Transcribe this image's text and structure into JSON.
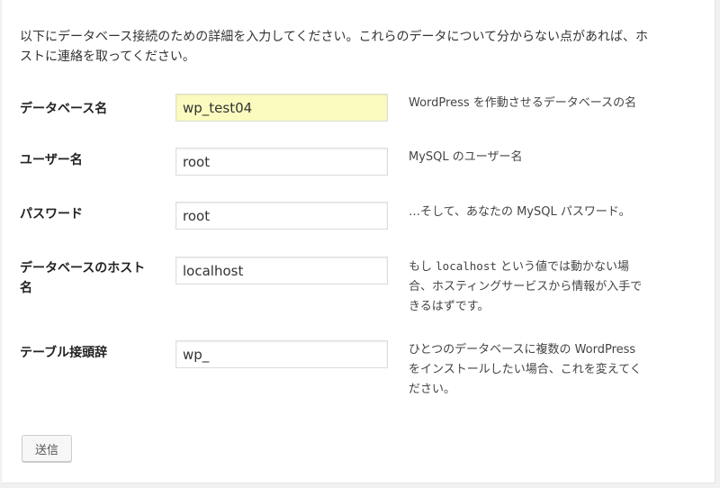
{
  "intro": {
    "line1": "以下にデータベース接続のための詳細を入力してください。これらのデータについて分からない点があれば、ホ",
    "line2": "ストに連絡を取ってください。"
  },
  "fields": {
    "dbname": {
      "label": "データベース名",
      "value": "wp_test04",
      "description": "WordPress を作動させるデータベースの名"
    },
    "username": {
      "label": "ユーザー名",
      "value": "root",
      "description": "MySQL のユーザー名"
    },
    "password": {
      "label": "パスワード",
      "value": "root",
      "description": "…そして、あなたの MySQL パスワード。"
    },
    "dbhost": {
      "label_line1": "データベースのホスト",
      "label_line2": "名",
      "value": "localhost",
      "description_pre": "もし ",
      "description_code": "localhost",
      "description_post": " という値では動かない場",
      "description_line2": "合、ホスティングサービスから情報が入手で",
      "description_line3": "きるはずです。"
    },
    "prefix": {
      "label": "テーブル接頭辞",
      "value": "wp_",
      "description_line1": "ひとつのデータベースに複数の WordPress",
      "description_line2": "をインストールしたい場合、これを変えてく",
      "description_line3": "ださい。"
    }
  },
  "submit_label": "送信",
  "colors": {
    "highlight_field": "#fbfbbf",
    "page_background": "#f1f1f1",
    "panel_background": "#ffffff"
  }
}
